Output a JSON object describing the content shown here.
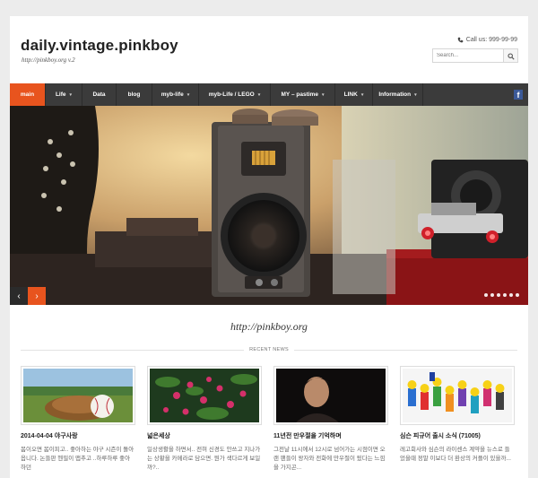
{
  "header": {
    "site_title": "daily.vintage.pinkboy",
    "tagline": "http://pinkboy.org v.2",
    "call_label": "Call us: 999-99-99",
    "search_placeholder": "Search..."
  },
  "nav": {
    "items": [
      {
        "label": "main",
        "active": true,
        "dropdown": false
      },
      {
        "label": "Life",
        "active": false,
        "dropdown": true
      },
      {
        "label": "Data",
        "active": false,
        "dropdown": false
      },
      {
        "label": "blog",
        "active": false,
        "dropdown": false
      },
      {
        "label": "myb-life",
        "active": false,
        "dropdown": true
      },
      {
        "label": "myb-Life / LEGO",
        "active": false,
        "dropdown": true
      },
      {
        "label": "MY – pastime",
        "active": false,
        "dropdown": true
      },
      {
        "label": "LINK",
        "active": false,
        "dropdown": true
      },
      {
        "label": "Information",
        "active": false,
        "dropdown": true
      }
    ],
    "social_icon": "facebook-icon"
  },
  "slider": {
    "prev_icon": "chevron-left-icon",
    "next_icon": "chevron-right-icon",
    "slide_count": 6,
    "accent": "#e8541e"
  },
  "main": {
    "url_line": "http://pinkboy.org",
    "recent_label": "RECENT NEWS",
    "cards": [
      {
        "title": "2014-04-04 야구사랑",
        "excerpt": "봄이오면 봄이피고.. 좋아하는 야구 시즌이 돌아옵니다. 논들판 헨필이 맵추고 ..하루하루 좋아하던"
      },
      {
        "title": "넓은세상",
        "excerpt": "일상생활을 하면서.. 전혀 신경도 안쓰고 지나가는 상황을 카메라로 담으면. 뭔가 색다르게 보일까?.."
      },
      {
        "title": "11년전 만우절을 기억하며",
        "excerpt": "그전날 11시에서 12시로 넘어가는 시점이면 오랜 팬들이 왕자와 전화에 만우절이 됬다는 느낌을 가지곤..."
      },
      {
        "title": "심슨 피규어 출시 소식 (71005)",
        "excerpt": "레고회사와 심슨의 라이센스 계약을 뉴스로 들었을때 정말 이보다 더 환상의 커플이 있을까..."
      }
    ]
  },
  "colors": {
    "accent": "#e8541e",
    "nav_bg": "#3b3b3b",
    "facebook": "#3b5998"
  }
}
